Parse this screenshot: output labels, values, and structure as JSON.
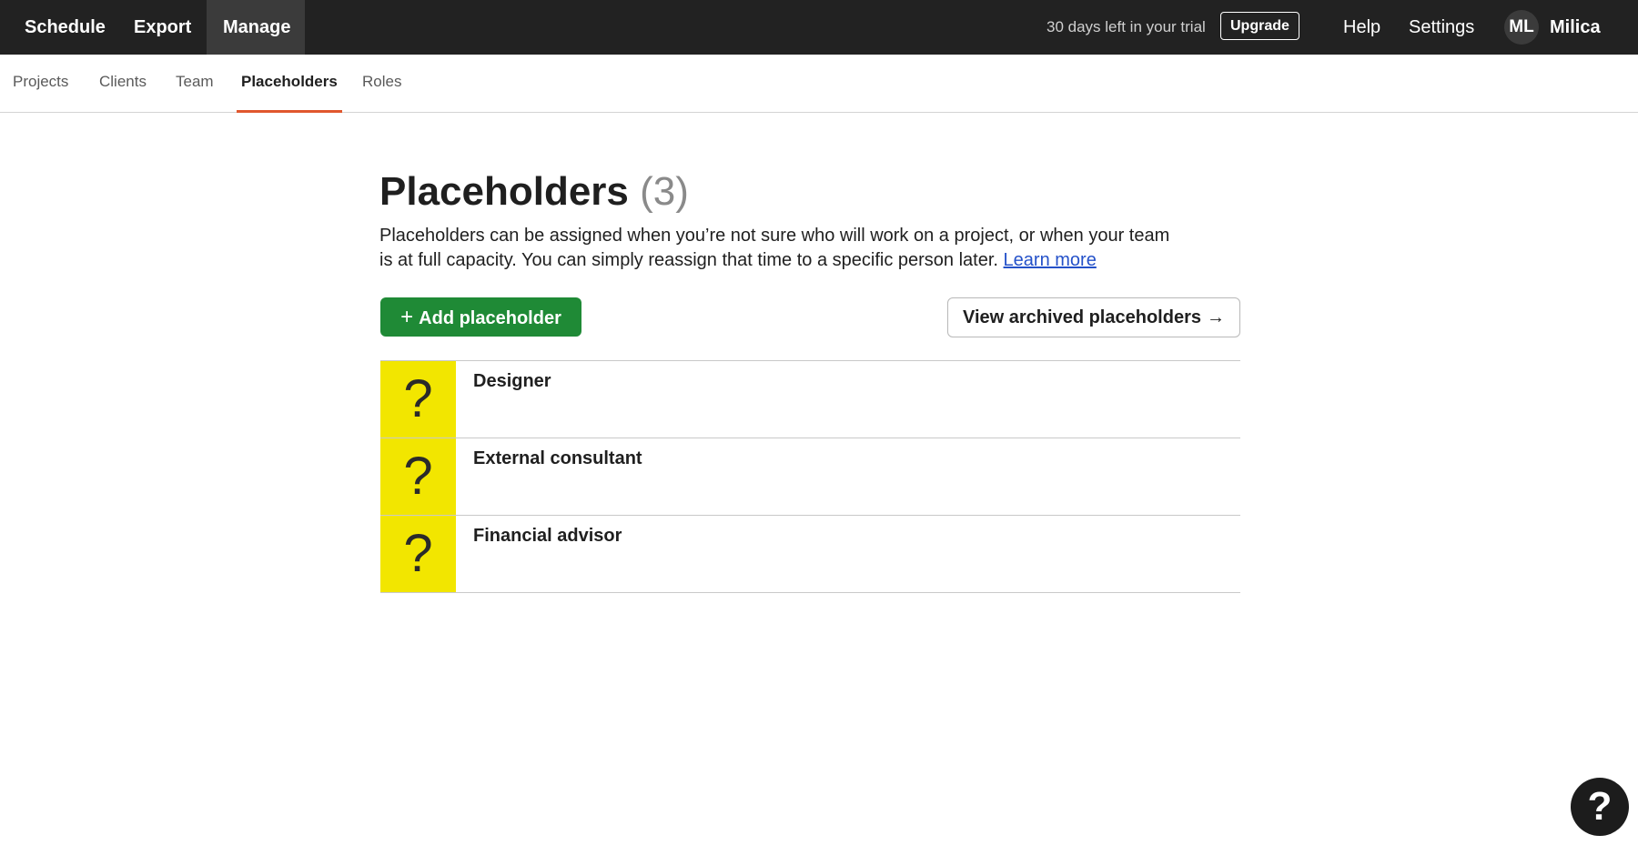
{
  "topbar": {
    "nav": [
      {
        "label": "Schedule"
      },
      {
        "label": "Export"
      },
      {
        "label": "Manage"
      }
    ],
    "trial_text": "30 days left in your trial",
    "upgrade_label": "Upgrade",
    "help_label": "Help",
    "settings_label": "Settings",
    "avatar_initials": "ML",
    "username": "Milica"
  },
  "subnav": {
    "tabs": [
      {
        "label": "Projects"
      },
      {
        "label": "Clients"
      },
      {
        "label": "Team"
      },
      {
        "label": "Placeholders"
      },
      {
        "label": "Roles"
      }
    ],
    "active": "Placeholders"
  },
  "main": {
    "title": "Placeholders",
    "count": "(3)",
    "description": "Placeholders can be assigned when you’re not sure who will work on a project, or when your team is at full capacity. You can simply reassign that time to a specific person later.",
    "learn_more": "Learn more",
    "add_button": "Add placeholder",
    "add_icon": "+",
    "archived_button": "View archived placeholders",
    "archived_icon": "→",
    "placeholders": [
      {
        "name": "Designer",
        "icon": "?"
      },
      {
        "name": "External consultant",
        "icon": "?"
      },
      {
        "name": "Financial advisor",
        "icon": "?"
      }
    ]
  },
  "help_fab": {
    "icon": "?"
  },
  "colors": {
    "topbar_bg": "#222222",
    "accent_tab": "#e0572e",
    "primary_button": "#1f8a36",
    "placeholder_icon_bg": "#f2e600",
    "link": "#2451c9"
  }
}
